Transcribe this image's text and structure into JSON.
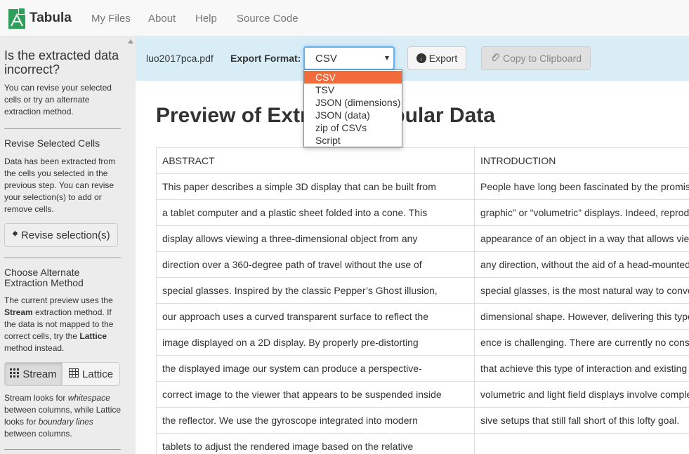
{
  "brand": {
    "name": "Tabula"
  },
  "nav": [
    "My Files",
    "About",
    "Help",
    "Source Code"
  ],
  "sidebar": {
    "title": "Is the extracted data incorrect?",
    "intro": "You can revise your selected cells or try an alternate extraction method.",
    "revise_heading": "Revise Selected Cells",
    "revise_text": "Data has been extracted from the cells you selected in the previous step. You can revise your selection(s) to add or remove cells.",
    "revise_button": "Revise selection(s)",
    "method_heading": "Choose Alternate Extraction Method",
    "method_text_1": "The current preview uses the ",
    "method_stream": "Stream",
    "method_text_2": " extraction method. If the data is not mapped to the correct cells, try the ",
    "method_lattice": "Lattice",
    "method_text_3": " method instead.",
    "stream_button": "Stream",
    "lattice_button": "Lattice",
    "desc_1": "Stream looks for ",
    "desc_whitespace": "whitespace",
    "desc_2": " between columns, while Lattice looks for ",
    "desc_boundary": "boundary lines",
    "desc_3": " between columns."
  },
  "export": {
    "filename": "luo2017pca.pdf",
    "format_label": "Export Format:",
    "selected": "CSV",
    "options": [
      "CSV",
      "TSV",
      "JSON (dimensions)",
      "JSON (data)",
      "zip of CSVs",
      "Script"
    ],
    "export_button": "Export",
    "copy_button": "Copy to Clipboard"
  },
  "preview": {
    "title": "Preview of Extracted Tabular Data",
    "rows": [
      [
        "ABSTRACT",
        "INTRODUCTION"
      ],
      [
        "This paper describes a simple 3D display that can be built from",
        "People have long been fascinated by the promise"
      ],
      [
        "a tablet computer and a plastic sheet folded into a cone. This",
        "graphic” or “volumetric” displays. Indeed, reprodu"
      ],
      [
        "display allows viewing a three-dimensional object from any",
        "appearance of an object in a way that allows view"
      ],
      [
        "direction over a 360-degree path of travel without the use of",
        "any direction, without the aid of a head-mounted"
      ],
      [
        "special glasses. Inspired by the classic Pepper’s Ghost illusion,",
        "special glasses, is the most natural way to conve"
      ],
      [
        "our approach uses a curved transparent surface to reflect the",
        "dimensional shape. However, delivering this type"
      ],
      [
        "image displayed on a 2D display. By properly pre-distorting",
        "ence is challenging. There are currently no consu"
      ],
      [
        "the displayed image our system can produce a perspective-",
        "that achieve this type of interaction and existing"
      ],
      [
        "correct image to the viewer that appears to be suspended inside",
        "volumetric and light field displays involve comple"
      ],
      [
        "the reflector. We use the gyroscope integrated into modern",
        "sive setups that still fall short of this lofty goal."
      ],
      [
        "tablets to adjust the rendered image based on the relative",
        ""
      ]
    ]
  }
}
